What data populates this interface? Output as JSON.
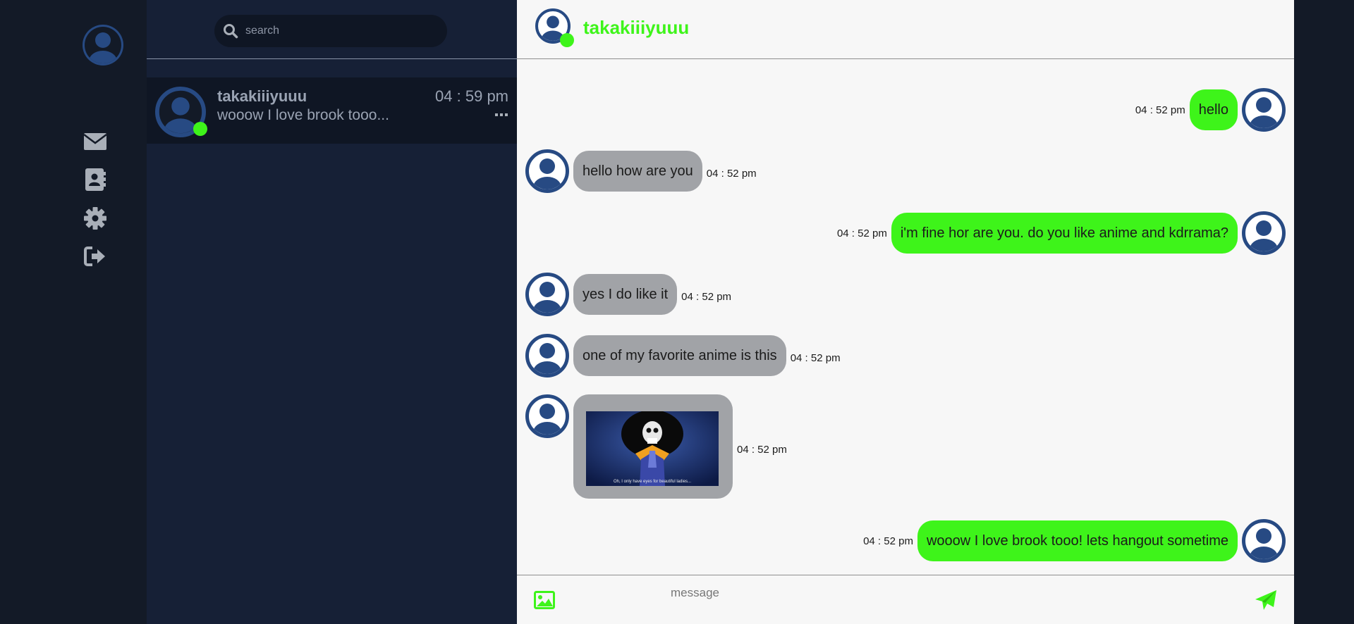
{
  "colors": {
    "accent": "#3ef41a",
    "avatar": "#274a83",
    "incoming_bubble": "#a1a3a7"
  },
  "rail": {
    "icons": [
      "user-avatar-icon",
      "envelope-icon",
      "address-book-icon",
      "gear-icon",
      "sign-out-icon"
    ]
  },
  "search": {
    "placeholder": "search"
  },
  "conversation": {
    "name": "takakiiiyuuu",
    "time": "04 : 59 pm",
    "preview": "wooow I love brook tooo..."
  },
  "chat": {
    "title": "takakiiiyuuu",
    "messages": [
      {
        "dir": "out",
        "text": "hello",
        "time": "04 : 52 pm"
      },
      {
        "dir": "in",
        "text": "hello how are you",
        "time": "04 : 52 pm"
      },
      {
        "dir": "out",
        "text": "i'm fine hor are you. do you like anime and kdrrama?",
        "time": "04 : 52 pm"
      },
      {
        "dir": "in",
        "text": "yes I do like it",
        "time": "04 : 52 pm"
      },
      {
        "dir": "in",
        "text": "one of my favorite anime is this",
        "time": "04 : 52 pm"
      },
      {
        "dir": "in",
        "image_caption": "Oh, I only have eyes for beautiful ladies...",
        "time": "04 : 52 pm"
      },
      {
        "dir": "out",
        "text": "wooow I love brook tooo! lets hangout sometime",
        "time": "04 : 52 pm"
      }
    ]
  },
  "composer": {
    "placeholder": "message"
  }
}
